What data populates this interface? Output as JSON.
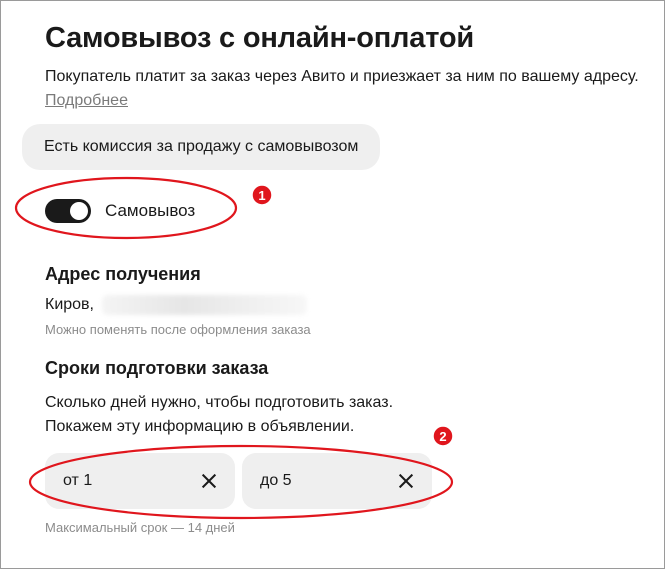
{
  "title": "Самовывоз с онлайн-оплатой",
  "description": "Покупатель платит за заказ через Авито и приезжает за ним по вашему адресу.",
  "more_link": "Подробнее",
  "commission_chip": "Есть комиссия за продажу с самовывозом",
  "pickup_toggle": {
    "label": "Самовывоз",
    "on": true
  },
  "address": {
    "heading": "Адрес получения",
    "city": "Киров,",
    "hint": "Можно поменять после оформления заказа"
  },
  "prep": {
    "heading": "Сроки подготовки заказа",
    "line1": "Сколько дней нужно, чтобы подготовить заказ.",
    "line2": "Покажем эту информацию в объявлении.",
    "from_value": "от 1",
    "to_value": "до 5",
    "hint": "Максимальный срок — 14 дней"
  },
  "annotations": {
    "marker1": "1",
    "marker2": "2",
    "color": "#e0161d"
  }
}
